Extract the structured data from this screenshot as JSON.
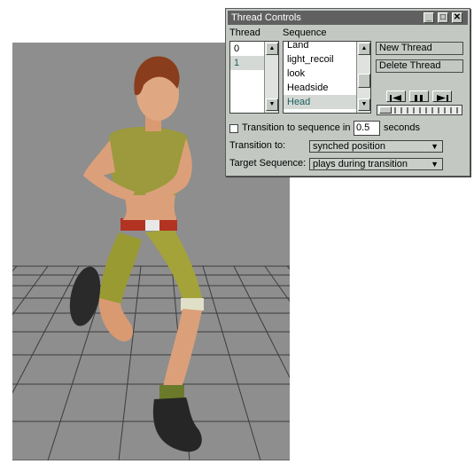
{
  "window": {
    "title": "Thread Controls",
    "controls": {
      "minimize": "_",
      "maximize": "□",
      "close": "✕"
    }
  },
  "thread": {
    "header": "Thread",
    "items": [
      "0",
      "1"
    ],
    "selected_index": 1
  },
  "sequence": {
    "header": "Sequence",
    "items": [
      "Land",
      "light_recoil",
      "look",
      "Headside",
      "Head"
    ],
    "selected_index": 4
  },
  "buttons": {
    "new_thread": "New Thread",
    "delete_thread": "Delete Thread"
  },
  "playback": {
    "rewind_icon": "rewind-icon",
    "pause_icon": "pause-icon",
    "play_icon": "play-icon",
    "position": 0.05
  },
  "transition": {
    "checkbox_label": "Transition to sequence in",
    "checked": false,
    "seconds_value": "0.5",
    "seconds_label": "seconds",
    "to_label": "Transition to:",
    "to_value": "synched position",
    "target_label": "Target Sequence:",
    "target_value": "plays during transition"
  },
  "colors": {
    "panel": "#c3c8c3",
    "titlebar": "#606060",
    "viewport_bg": "#8e8e8e",
    "grid": "#3c3c3c",
    "selection_text": "#1f5f5f"
  }
}
